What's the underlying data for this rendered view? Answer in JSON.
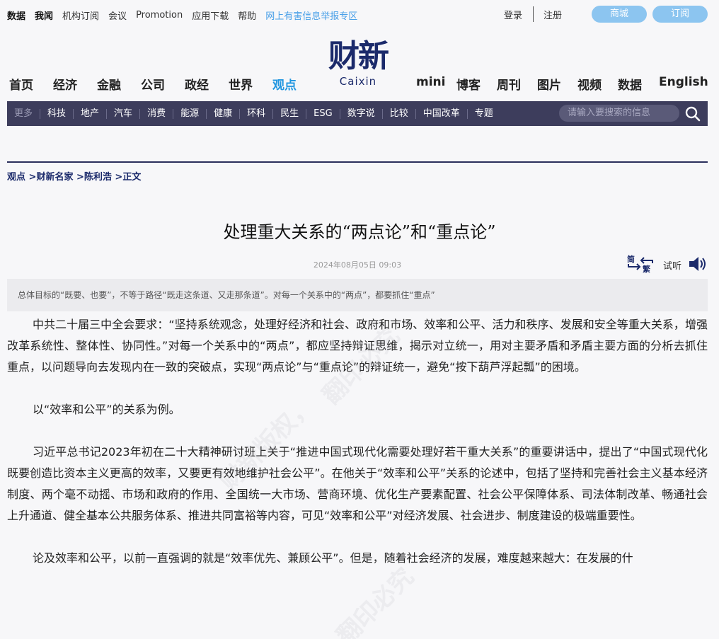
{
  "top_links": [
    "数据",
    "我闻",
    "机构订阅",
    "会议",
    "Promotion",
    "应用下载",
    "帮助",
    "网上有害信息举报专区"
  ],
  "auth": {
    "login": "登录",
    "register": "注册"
  },
  "buttons": {
    "mall": "商城",
    "subscribe": "订阅"
  },
  "logo": {
    "cn": "财新",
    "en": "Caixin"
  },
  "main_nav": [
    "首页",
    "经济",
    "金融",
    "公司",
    "政经",
    "世界",
    "观点",
    "mini",
    "博客",
    "周刊",
    "图片",
    "视频",
    "数据",
    "English"
  ],
  "main_nav_active": "观点",
  "sub_nav": [
    "更多",
    "科技",
    "地产",
    "汽车",
    "消费",
    "能源",
    "健康",
    "环科",
    "民生",
    "ESG",
    "数字说",
    "比较",
    "中国改革",
    "专题"
  ],
  "search": {
    "placeholder": "请输入要搜索的信息"
  },
  "breadcrumb": [
    "观点",
    ">财新名家",
    ">陈利浩",
    ">正文"
  ],
  "article": {
    "title": "处理重大关系的“两点论”和“重点论”",
    "date": "2024年08月05日 09:03",
    "listen_label": "试听",
    "trad_simp": {
      "simp": "简",
      "trad": "繁"
    },
    "summary": "总体目标的“既要、也要”，不等于路径“既走这条道、又走那条道”。对每一个关系中的“两点”，都要抓住“重点”",
    "paragraphs": [
      "中共二十届三中全会要求：“坚持系统观念，处理好经济和社会、政府和市场、效率和公平、活力和秩序、发展和安全等重大关系，增强改革系统性、整体性、协同性。”对每一个关系中的“两点”，都应坚持辩证思维，揭示对立统一，用对主要矛盾和矛盾主要方面的分析去抓住重点，以问题导向去发现内在一致的突破点，实现“两点论”与“重点论”的辩证统一，避免“按下葫芦浮起瓢”的困境。",
      "以“效率和公平”的关系为例。",
      "习近平总书记2023年初在二十大精神研讨班上关于“推进中国式现代化需要处理好若干重大关系”的重要讲话中，提出了“中国式现代化既要创造比资本主义更高的效率，又要更有效地维护社会公平”。在他关于“效率和公平”关系的论述中，包括了坚持和完善社会主义基本经济制度、两个毫不动摇、市场和政府的作用、全国统一大市场、营商环境、优化生产要素配置、社会公平保障体系、司法体制改革、畅通社会上升通道、健全基本公共服务体系、推进共同富裕等内容，可见“效率和公平”对经济发展、社会进步、制度建设的极端重要性。",
      "论及效率和公平，以前一直强调的就是“效率优先、兼顾公平”。但是，随着社会经济的发展，难度越来越大：在发展的什"
    ]
  },
  "watermark": [
    "财新版权，",
    "翻印必究"
  ],
  "colors": {
    "brand": "#1b2a6b",
    "accent": "#2196e0",
    "subnav_bg": "#3d3d5c",
    "pill": "#8cc5f0"
  }
}
